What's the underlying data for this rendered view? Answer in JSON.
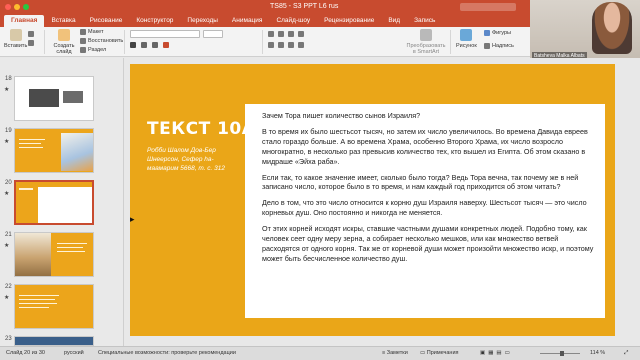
{
  "window": {
    "title": "TS85 - S3 PPT L6 rus",
    "brand_color": "#c84b2f"
  },
  "ribbon": {
    "tabs": [
      "Главная",
      "Вставка",
      "Рисование",
      "Конструктор",
      "Переходы",
      "Анимация",
      "Слайд-шоу",
      "Рецензирование",
      "Вид",
      "Запись"
    ],
    "paste_label": "Вставить",
    "new_slide_label": "Создать слайд",
    "layout_label": "Макет",
    "reset_label": "Восстановить",
    "section_label": "Раздел",
    "smartart_label": "Преобразовать в SmartArt",
    "picture_label": "Рисунок",
    "shapes_label": "Фигуры",
    "caption_label": "Надпись"
  },
  "video": {
    "participant_name": "Batsheva Malka Albats"
  },
  "sidebar": {
    "slides": [
      {
        "number": "18",
        "star": "★"
      },
      {
        "number": "19",
        "star": "★"
      },
      {
        "number": "20",
        "star": "★"
      },
      {
        "number": "21",
        "star": "★"
      },
      {
        "number": "22",
        "star": "★"
      },
      {
        "number": "23",
        "star": ""
      }
    ]
  },
  "slide": {
    "title": "ТЕКСТ 10А",
    "subtitle": "Робби Шалом Дов-Бер Шнеерсон, Сефер ha-маамарим 5668, т. с. 312",
    "accent_color": "#eaa618",
    "paragraphs": [
      "Зачем Тора пишет количество сынов Израиля?",
      "В то время их было шестьсот тысяч, но затем их число увеличилось. Во времена Давида евреев стало гораздо больше. А во времена Храма, особенно Второго Храма, их число возросло многократно, в несколько раз превысив количество тех, кто вышел из Египта. Об этом сказано в мидраше «Эйха раба».",
      "Если так, то какое значение имеет, сколько было тогда? Ведь Тора вечна, так почему же в ней записано число, которое было в то время, и нам каждый год приходится об этом читать?",
      "Дело в том, что это число относится к корню душ Израиля наверху. Шестьсот тысяч — это число корневых душ. Оно постоянно и никогда не меняется.",
      "От этих корней исходят искры, ставшие частными душами конкретных людей. Подобно тому, как человек сеет одну меру зерна, а собирает несколько мешков, или как множество ветвей расходятся от одного корня. Так же от корневой души может произойти множество искр, и поэтому может быть бесчисленное количество душ."
    ]
  },
  "statusbar": {
    "slide_counter": "Слайд 20 из 30",
    "language": "русский",
    "accessibility": "Специальные возможности: проверьте рекомендации",
    "notes_label": "Заметки",
    "comments_label": "Примечания",
    "zoom": "114 %"
  }
}
